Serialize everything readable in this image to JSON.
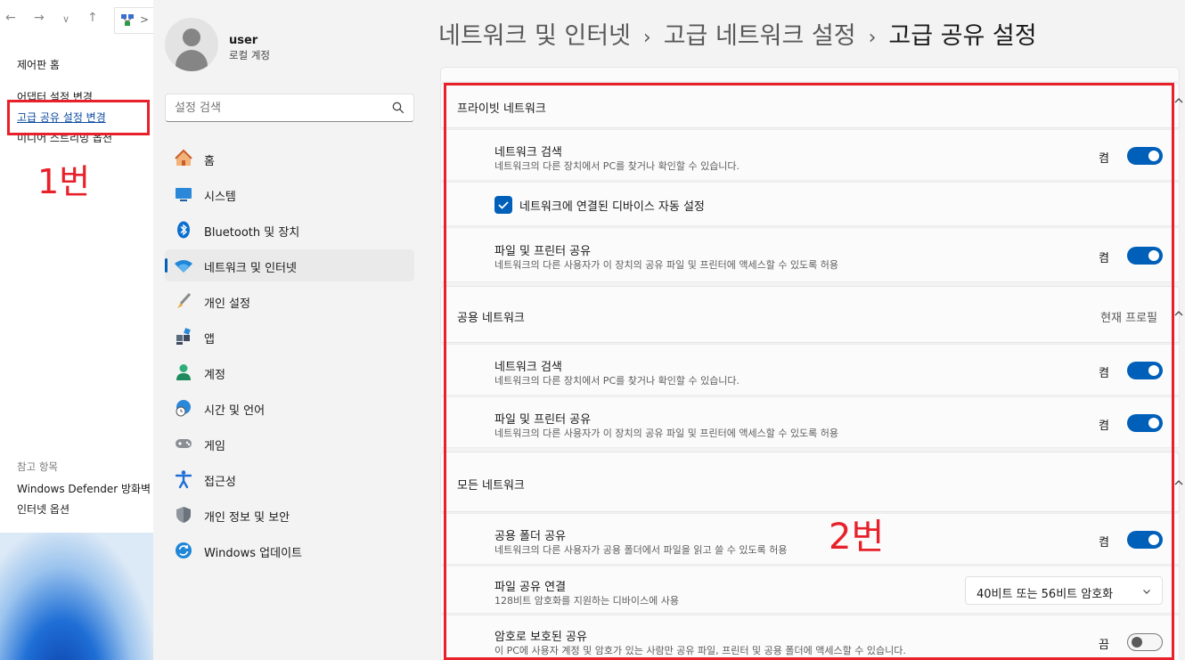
{
  "control_panel": {
    "nav": {
      "back": "←",
      "forward": "→",
      "dropdown": "∨",
      "up": "↑",
      "address_chevron": ">"
    },
    "links": {
      "home": "제어판 홈",
      "adapter": "어댑터 설정 변경",
      "advanced_sharing": "고급 공유 설정 변경",
      "media_streaming": "미디어 스트리밍 옵션"
    },
    "see_also": {
      "heading": "참고 항목",
      "firewall": "Windows Defender 방화벽",
      "internet_options": "인터넷 옵션"
    },
    "annotation": "1번"
  },
  "settings": {
    "profile": {
      "name": "user",
      "account_type": "로컬 계정"
    },
    "search": {
      "placeholder": "설정 검색"
    },
    "nav": [
      {
        "label": "홈",
        "icon": "home-icon"
      },
      {
        "label": "시스템",
        "icon": "system-icon"
      },
      {
        "label": "Bluetooth 및 장치",
        "icon": "bluetooth-icon"
      },
      {
        "label": "네트워크 및 인터넷",
        "icon": "wifi-icon",
        "selected": true
      },
      {
        "label": "개인 설정",
        "icon": "brush-icon"
      },
      {
        "label": "앱",
        "icon": "apps-icon"
      },
      {
        "label": "계정",
        "icon": "account-icon"
      },
      {
        "label": "시간 및 언어",
        "icon": "globe-clock-icon"
      },
      {
        "label": "게임",
        "icon": "gamepad-icon"
      },
      {
        "label": "접근성",
        "icon": "accessibility-icon"
      },
      {
        "label": "개인 정보 및 보안",
        "icon": "shield-icon"
      },
      {
        "label": "Windows 업데이트",
        "icon": "update-icon"
      }
    ],
    "breadcrumb": {
      "level1": "네트워크 및 인터넷",
      "level2": "고급 네트워크 설정",
      "current": "고급 공유 설정",
      "separator": "›"
    },
    "private_network": {
      "title": "프라이빗 네트워크",
      "network_discovery": {
        "title": "네트워크 검색",
        "desc": "네트워크의 다른 장치에서 PC를 찾거나 확인할 수 있습니다.",
        "state": "켬",
        "on": true
      },
      "auto_setup": {
        "label": "네트워크에 연결된 디바이스 자동 설정",
        "checked": true
      },
      "file_printer": {
        "title": "파일 및 프린터 공유",
        "desc": "네트워크의 다른 사용자가 이 장치의 공유 파일 및 프린터에 액세스할 수 있도록 허용",
        "state": "켬",
        "on": true
      }
    },
    "public_network": {
      "title": "공용 네트워크",
      "current_profile": "현재 프로필",
      "network_discovery": {
        "title": "네트워크 검색",
        "desc": "네트워크의 다른 장치에서 PC를 찾거나 확인할 수 있습니다.",
        "state": "켬",
        "on": true
      },
      "file_printer": {
        "title": "파일 및 프린터 공유",
        "desc": "네트워크의 다른 사용자가 이 장치의 공유 파일 및 프린터에 액세스할 수 있도록 허용",
        "state": "켬",
        "on": true
      }
    },
    "all_networks": {
      "title": "모든 네트워크",
      "public_folder": {
        "title": "공용 폴더 공유",
        "desc": "네트워크의 다른 사용자가 공용 폴더에서 파일을 읽고 쓸 수 있도록 허용",
        "state": "켬",
        "on": true
      },
      "file_sharing_connection": {
        "title": "파일 공유 연결",
        "desc": "128비트 암호화를 지원하는 디바이스에 사용",
        "selected": "40비트 또는 56비트 암호화"
      },
      "password_protected": {
        "title": "암호로 보호된 공유",
        "desc": "이 PC에 사용자 계정 및 암호가 있는 사람만 공유 파일, 프린터 및 공용 폴더에 액세스할 수 있습니다.",
        "state": "끔",
        "on": false
      }
    },
    "annotation": "2번"
  },
  "colors": {
    "accent": "#005fb8",
    "annotation_red": "#e8202a",
    "link_blue": "#0b4aa0"
  }
}
